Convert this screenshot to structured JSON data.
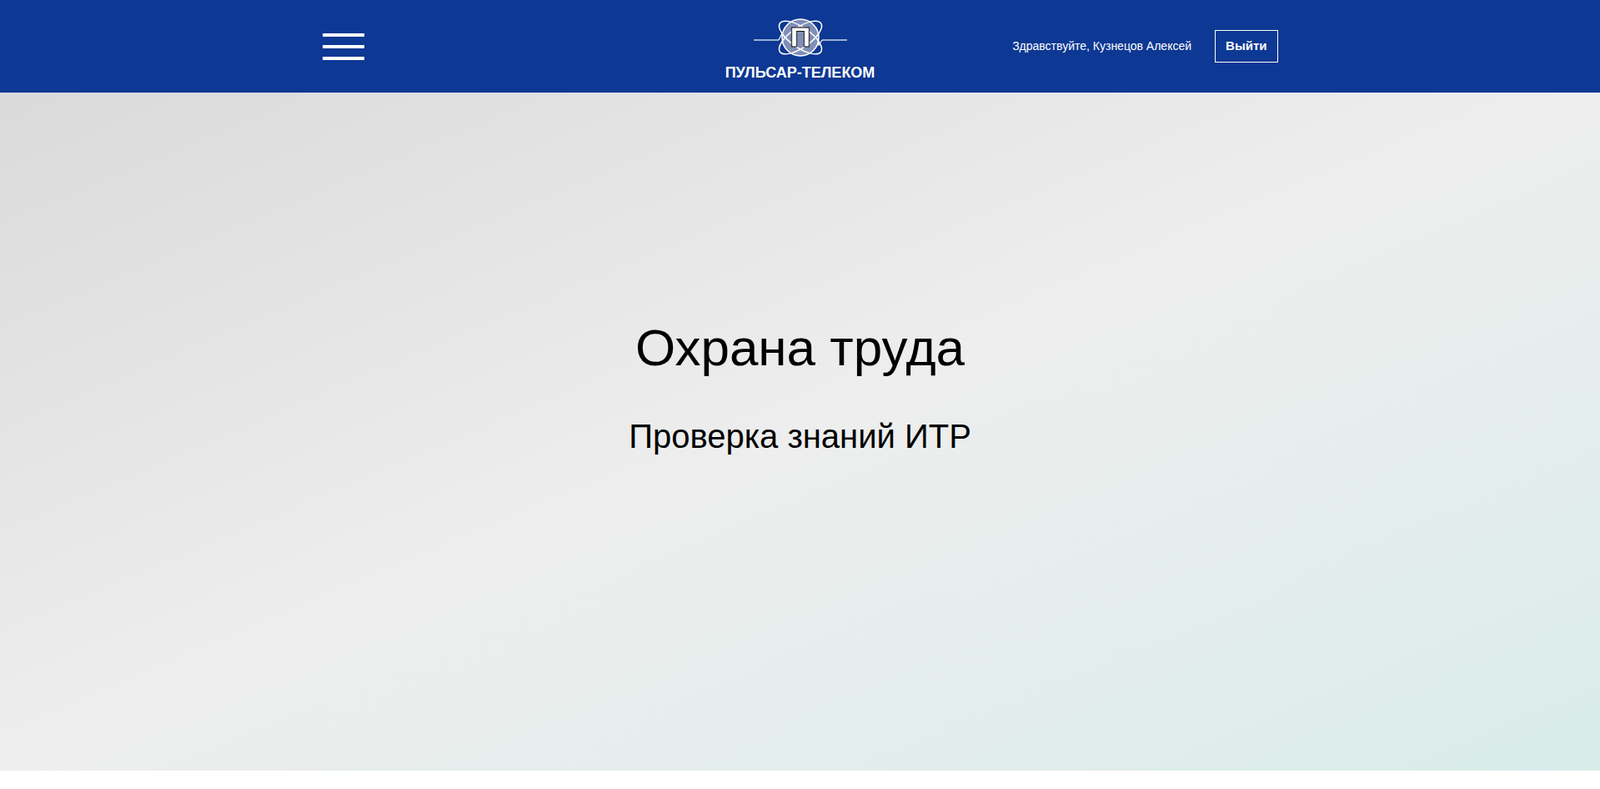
{
  "header": {
    "logo": {
      "mark": "П",
      "name": "ПУЛЬСАР-ТЕЛЕКОМ"
    },
    "greeting": "Здравствуйте, Кузнецов Алексей",
    "logout_button": "Выйти"
  },
  "hero": {
    "title": "Охрана труда",
    "subtitle": "Проверка знаний ИТР"
  }
}
